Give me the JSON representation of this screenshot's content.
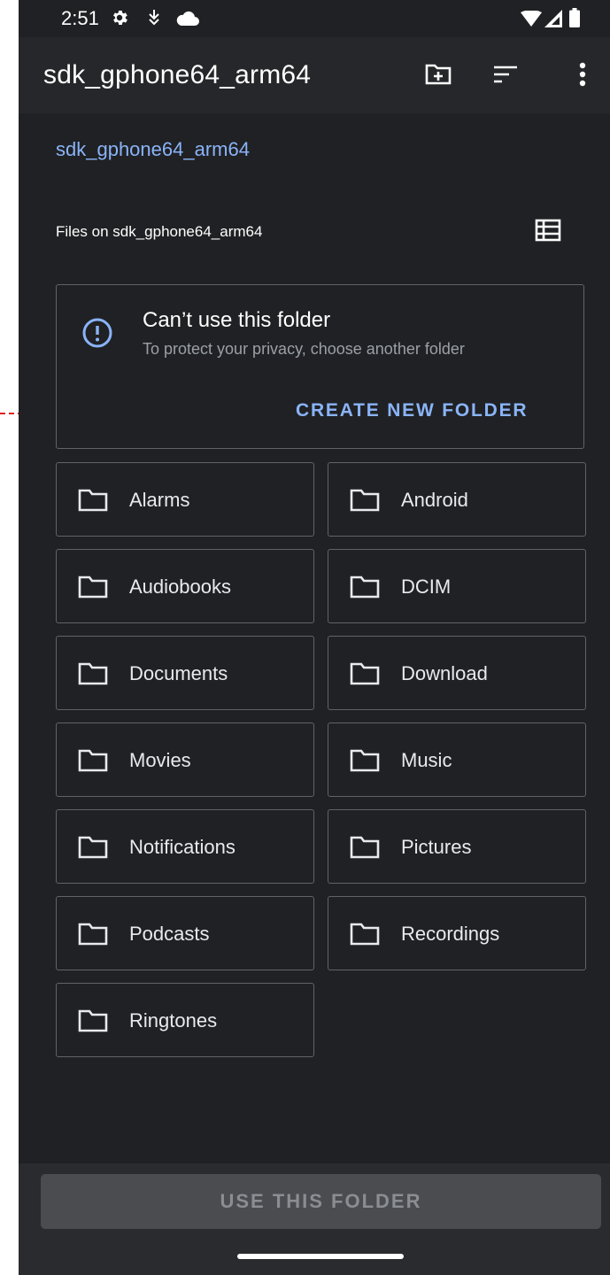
{
  "status_bar": {
    "time": "2:51",
    "icons": [
      "gear-icon",
      "download-icon",
      "cloud-icon",
      "wifi-icon",
      "signal-icon",
      "battery-icon"
    ]
  },
  "app_bar": {
    "title": "sdk_gphone64_arm64",
    "actions": [
      "new-folder-icon",
      "sort-icon",
      "more-vert-icon"
    ]
  },
  "breadcrumb": "sdk_gphone64_arm64",
  "section_header": "Files on sdk_gphone64_arm64",
  "warning": {
    "title": "Can’t use this folder",
    "subtitle": "To protect your privacy, choose another folder",
    "action_label": "CREATE NEW FOLDER"
  },
  "folders": [
    {
      "label": "Alarms"
    },
    {
      "label": "Android"
    },
    {
      "label": "Audiobooks"
    },
    {
      "label": "DCIM"
    },
    {
      "label": "Documents"
    },
    {
      "label": "Download"
    },
    {
      "label": "Movies"
    },
    {
      "label": "Music"
    },
    {
      "label": "Notifications"
    },
    {
      "label": "Pictures"
    },
    {
      "label": "Podcasts"
    },
    {
      "label": "Recordings"
    },
    {
      "label": "Ringtones"
    }
  ],
  "bottom": {
    "use_folder_label": "USE THIS FOLDER"
  },
  "colors": {
    "background": "#202124",
    "accent": "#8ab4f8",
    "annotation": "#e0201c"
  }
}
